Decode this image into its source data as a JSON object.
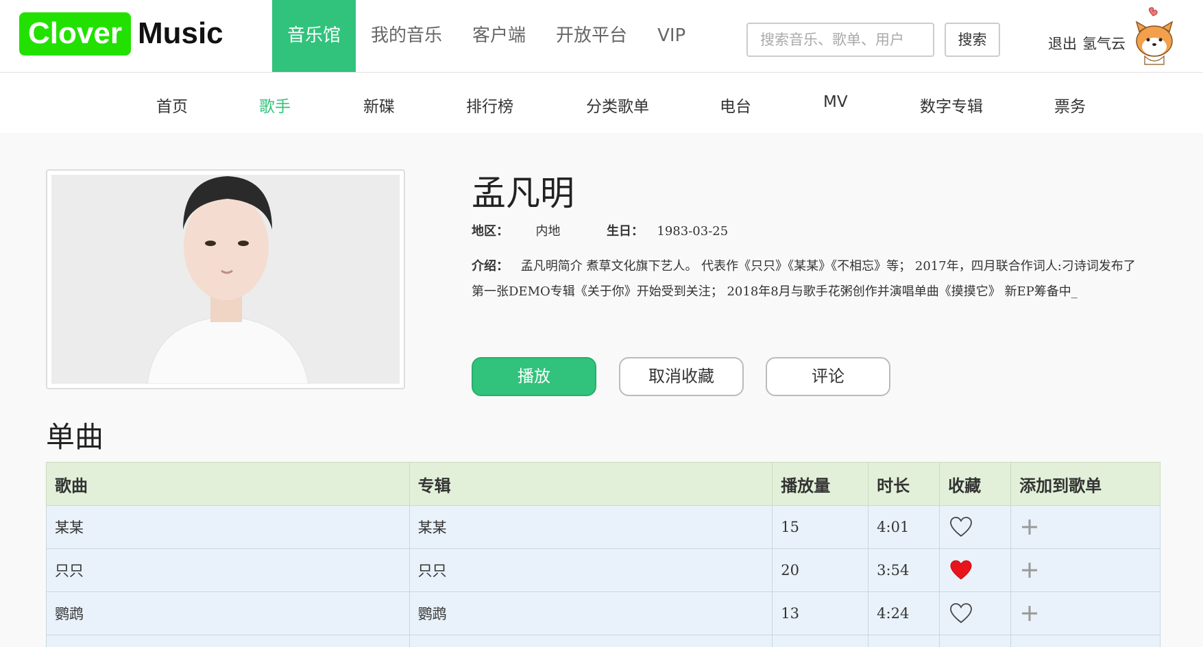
{
  "header": {
    "logo": {
      "part1": "Clover",
      "part2": "Music"
    },
    "nav": [
      {
        "label": "音乐馆",
        "active": true
      },
      {
        "label": "我的音乐",
        "active": false
      },
      {
        "label": "客户端",
        "active": false
      },
      {
        "label": "开放平台",
        "active": false
      },
      {
        "label": "VIP",
        "active": false
      }
    ],
    "search": {
      "placeholder": "搜索音乐、歌单、用户",
      "value": "",
      "button_label": "搜索"
    },
    "user": {
      "logout_label": "退出",
      "username": "氢气云"
    }
  },
  "subnav": [
    {
      "label": "首页",
      "active": false
    },
    {
      "label": "歌手",
      "active": true
    },
    {
      "label": "新碟",
      "active": false
    },
    {
      "label": "排行榜",
      "active": false
    },
    {
      "label": "分类歌单",
      "active": false
    },
    {
      "label": "电台",
      "active": false
    },
    {
      "label": "MV",
      "active": false
    },
    {
      "label": "数字专辑",
      "active": false
    },
    {
      "label": "票务",
      "active": false
    }
  ],
  "singer": {
    "name": "孟凡明",
    "region_label": "地区：",
    "region": "内地",
    "birthday_label": "生日：",
    "birthday": "1983-03-25",
    "intro_label": "介绍：",
    "intro": "孟凡明简介 煮草文化旗下艺人。 代表作《只只》《某某》《不相忘》等； 2017年，四月联合作词人:刁诗词发布了第一张DEMO专辑《关于你》开始受到关注； 2018年8月与歌手花粥创作并演唱单曲《摸摸它》 新EP筹备中_"
  },
  "actions": {
    "play": "播放",
    "unfavorite": "取消收藏",
    "comment": "评论"
  },
  "songs_section": {
    "title": "单曲",
    "columns": [
      "歌曲",
      "专辑",
      "播放量",
      "时长",
      "收藏",
      "添加到歌单"
    ],
    "rows": [
      {
        "song": "某某",
        "album": "某某",
        "plays": "15",
        "duration": "4:01",
        "favorited": false
      },
      {
        "song": "只只",
        "album": "只只",
        "plays": "20",
        "duration": "3:54",
        "favorited": true
      },
      {
        "song": "鹦鹉",
        "album": "鹦鹉",
        "plays": "13",
        "duration": "4:24",
        "favorited": false
      }
    ]
  },
  "colors": {
    "accent": "#31c27c",
    "logo_green": "#22e100",
    "heart_red": "#e8141c",
    "table_header": "#e2f0d9",
    "table_row": "#e9f2fa"
  }
}
